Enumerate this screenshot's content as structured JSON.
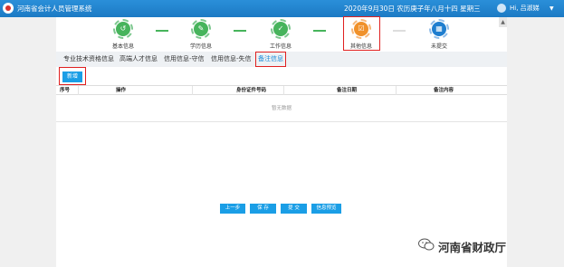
{
  "app": {
    "title": "河南省会计人员管理系统"
  },
  "header": {
    "date_text": "2020年9月30日  农历庚子年八月十四  星期三",
    "user": "Hi,  吕淑娣"
  },
  "steps": [
    {
      "label": "基本信息",
      "status": "done"
    },
    {
      "label": "学历信息",
      "status": "done"
    },
    {
      "label": "工作信息",
      "status": "done"
    },
    {
      "label": "其他信息",
      "status": "current"
    },
    {
      "label": "未提交",
      "status": "pending"
    }
  ],
  "tabs": [
    {
      "label": "专业技术资格信息",
      "active": false
    },
    {
      "label": "高端人才信息",
      "active": false
    },
    {
      "label": "信用信息-守信",
      "active": false
    },
    {
      "label": "信用信息-失信",
      "active": false
    },
    {
      "label": "备注信息",
      "active": true
    }
  ],
  "toolbar": {
    "add_label": "新增"
  },
  "table": {
    "columns": [
      "序号",
      "操作",
      "身份证件号码",
      "备注日期",
      "备注内容"
    ],
    "empty_text": "暂无数据"
  },
  "footer_buttons": [
    "上一步",
    "保 存",
    "提 交",
    "信息预览"
  ],
  "watermark": {
    "text": "河南省财政厅"
  },
  "colors": {
    "primary": "#1a9ee6",
    "done": "#47b45c",
    "current": "#f0912b",
    "highlight": "#e02020"
  }
}
